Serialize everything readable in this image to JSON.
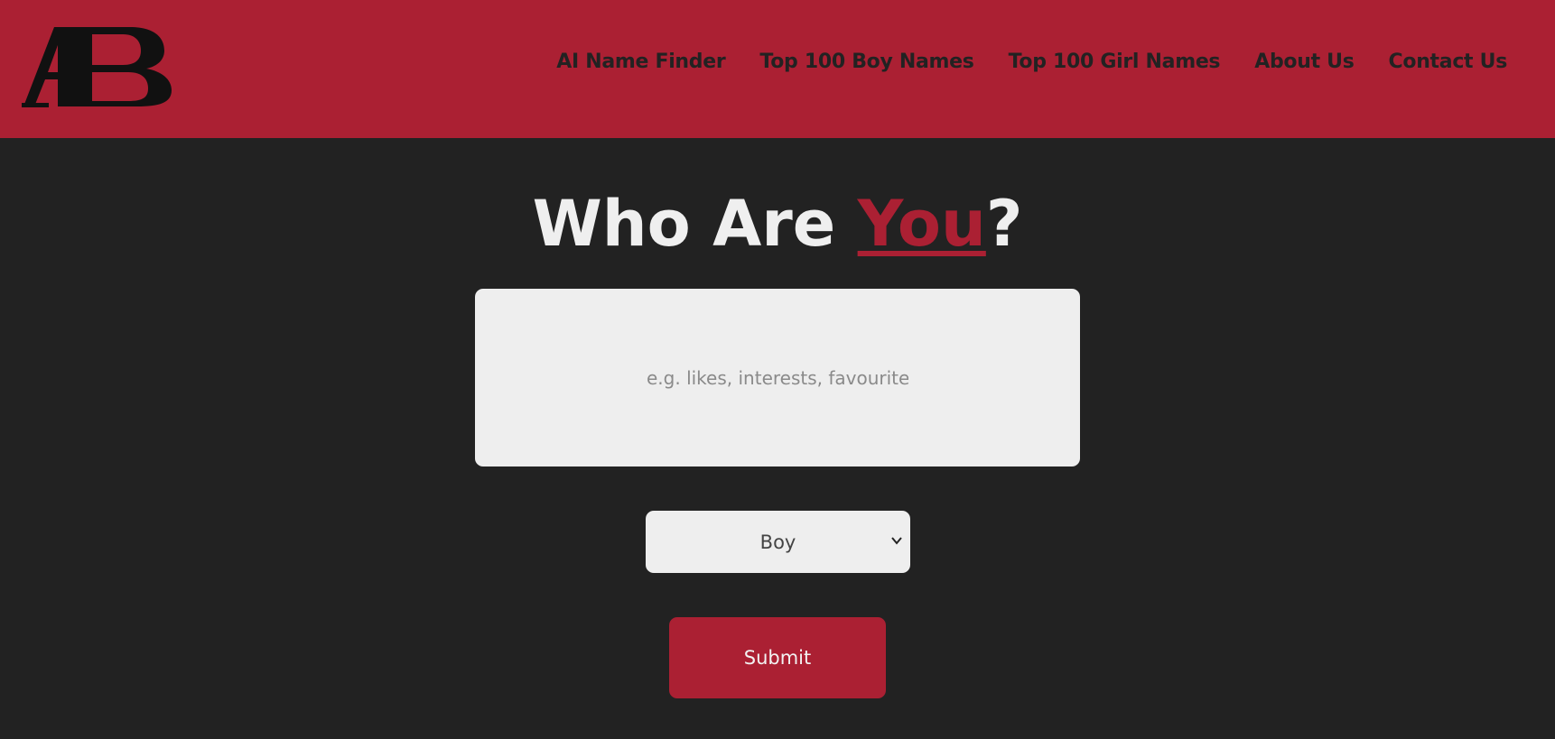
{
  "header": {
    "logo_text": "AB",
    "nav": [
      {
        "label": "AI Name Finder"
      },
      {
        "label": "Top 100 Boy Names"
      },
      {
        "label": "Top 100 Girl Names"
      },
      {
        "label": "About Us"
      },
      {
        "label": "Contact Us"
      }
    ]
  },
  "hero": {
    "title_pre": "Who Are ",
    "title_accent": "You",
    "title_post": "?"
  },
  "form": {
    "description_placeholder": "e.g. likes, interests, favourite t",
    "description_value": "",
    "gender_selected": "Boy",
    "submit_label": "Submit"
  },
  "colors": {
    "brand": "#ab2033",
    "background": "#222222",
    "field": "#eeeeee",
    "text_light": "#efefef"
  },
  "icons": {
    "select_arrow": "chevron-down-icon"
  }
}
